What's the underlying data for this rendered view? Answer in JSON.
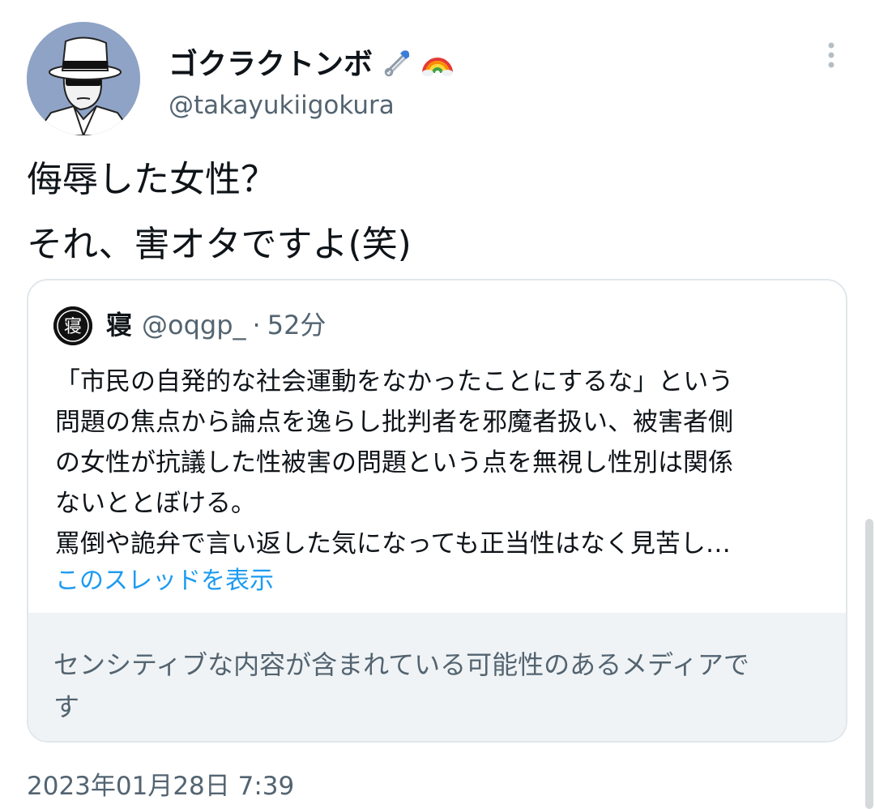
{
  "author": {
    "display_name": "ゴクラクトンボ",
    "handle": "@takayukiigokura",
    "name_icons": [
      "safety-pin-icon",
      "rainbow-icon"
    ]
  },
  "tweet": {
    "lines": [
      "侮辱した女性？",
      "それ、害オタですよ(笑)"
    ],
    "timestamp": "2023年01月28日 7:39"
  },
  "quoted_tweet": {
    "display_name": "寝",
    "avatar_glyph": "寝",
    "handle": "@oqgp_",
    "separator": "·",
    "time": "52分",
    "body_lines": [
      "「市民の自発的な社会運動をなかったことにするな」という",
      "問題の焦点から論点を逸らし批判者を邪魔者扱い、被害者側",
      "の女性が抗議した性被害の問題という点を無視し性別は関係",
      "ないととぼける。",
      "罵倒や詭弁で言い返した気になっても正当性はなく見苦し…"
    ],
    "show_thread_label": "このスレッドを表示",
    "sensitive_lines": [
      "センシティブな内容が含まれている可能性のあるメディアで",
      "す"
    ]
  },
  "colors": {
    "primary_text": "#0f1419",
    "secondary_text": "#536471",
    "link": "#1d9bf0",
    "border": "#e1e7eb",
    "sensitive_bg": "#f0f3f5",
    "avatar_bg": "#8fa3c6"
  }
}
